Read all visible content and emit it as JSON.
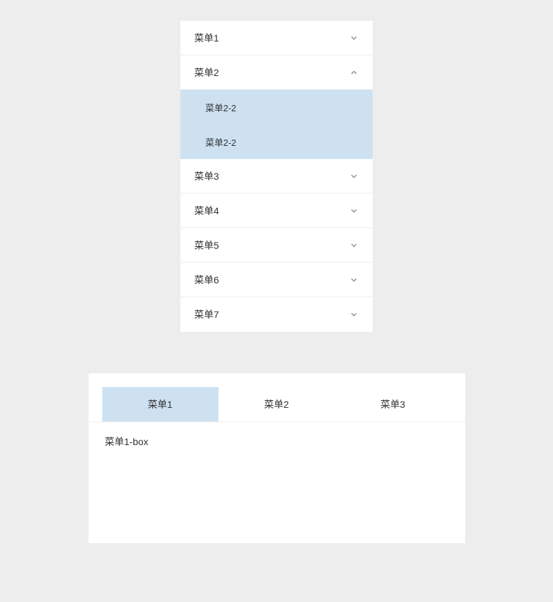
{
  "accordion": {
    "items": [
      {
        "label": "菜单1",
        "expanded": false,
        "sub": []
      },
      {
        "label": "菜单2",
        "expanded": true,
        "sub": [
          {
            "label": "菜单2-2"
          },
          {
            "label": "菜单2-2"
          }
        ]
      },
      {
        "label": "菜单3",
        "expanded": false,
        "sub": []
      },
      {
        "label": "菜单4",
        "expanded": false,
        "sub": []
      },
      {
        "label": "菜单5",
        "expanded": false,
        "sub": []
      },
      {
        "label": "菜单6",
        "expanded": false,
        "sub": []
      },
      {
        "label": "菜单7",
        "expanded": false,
        "sub": []
      }
    ]
  },
  "tabs": {
    "items": [
      {
        "label": "菜单1",
        "active": true
      },
      {
        "label": "菜单2",
        "active": false
      },
      {
        "label": "菜单3",
        "active": false
      }
    ],
    "panel": "菜单1-box"
  },
  "colors": {
    "accent_bg": "#cde1f1",
    "divider": "#eeeeee",
    "page_bg": "#ededed"
  }
}
